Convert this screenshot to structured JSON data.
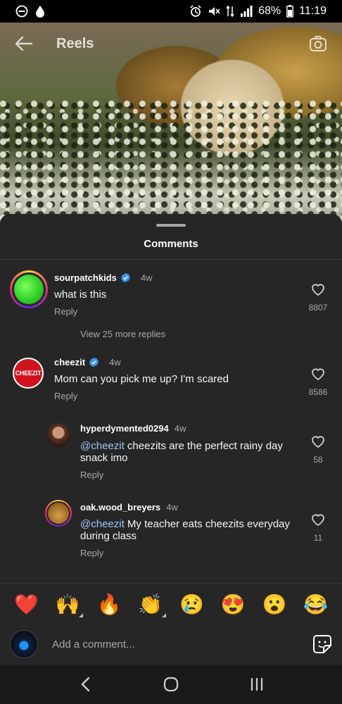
{
  "status_bar": {
    "battery": "68%",
    "time": "11:19"
  },
  "header": {
    "title": "Reels"
  },
  "sheet": {
    "title": "Comments"
  },
  "comments": [
    {
      "username": "sourpatchkids",
      "time": "4w",
      "text": "what is this",
      "reply_label": "Reply",
      "likes": "8807",
      "view_more": "View 25 more replies"
    },
    {
      "username": "cheezit",
      "avatar_text": "CHEEZIT",
      "time": "4w",
      "text": "Mom can you pick me up? I'm scared",
      "reply_label": "Reply",
      "likes": "8586"
    }
  ],
  "replies": [
    {
      "username": "hyperdymented0294",
      "time": "4w",
      "mention": "@cheezit",
      "text_line1": " cheezits are the perfect rainy day",
      "text_line2": "snack imo",
      "reply_label": "Reply",
      "likes": "58"
    },
    {
      "username": "oak.wood_breyers",
      "time": "4w",
      "mention": "@cheezit",
      "text_line1": " My teacher eats cheezits everyday",
      "text_line2": "during class",
      "reply_label": "Reply",
      "likes": "11"
    }
  ],
  "emojis": [
    "❤️",
    "🙌",
    "🔥",
    "👏",
    "😢",
    "😍",
    "😮",
    "😂"
  ],
  "input": {
    "placeholder": "Add a comment..."
  },
  "colors": {
    "sheet_bg": "#262626",
    "verified_blue": "#3897f0",
    "cheezit_red": "#d1121e"
  },
  "icons": [
    "back-arrow-icon",
    "camera-icon",
    "heart-icon",
    "verified-badge-icon",
    "sticker-icon",
    "nav-back-icon",
    "nav-home-icon",
    "nav-recents-icon"
  ]
}
